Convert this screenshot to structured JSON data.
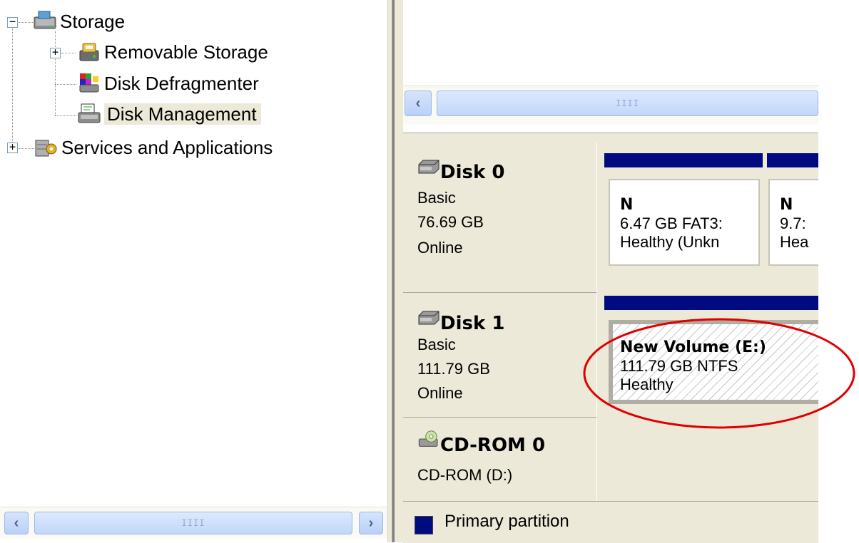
{
  "tree": {
    "storage": {
      "label": "Storage",
      "expander": "−",
      "icon": "storage-icon"
    },
    "removable_storage": {
      "label": "Removable Storage",
      "expander": "+",
      "icon": "removable-storage-icon"
    },
    "disk_defragmenter": {
      "label": "Disk Defragmenter",
      "icon": "defragmenter-icon"
    },
    "disk_management": {
      "label": "Disk Management",
      "icon": "disk-management-icon",
      "selected": true
    },
    "services": {
      "label": "Services and Applications",
      "expander": "+",
      "icon": "services-icon"
    }
  },
  "scroll": {
    "left": "‹",
    "right": "›",
    "grip": "IIII"
  },
  "disks": [
    {
      "name": "Disk 0",
      "type": "Basic",
      "size": "76.69 GB",
      "status": "Online",
      "partitions": [
        {
          "title": "N",
          "size": "6.47 GB FAT3:",
          "status": "Healthy (Unkn"
        },
        {
          "title": "N",
          "size": "9.7:",
          "status": "Hea"
        }
      ]
    },
    {
      "name": "Disk 1",
      "type": "Basic",
      "size": "111.79 GB",
      "status": "Online",
      "partitions": [
        {
          "title": "New Volume  (E:)",
          "size": "111.79 GB NTFS",
          "status": "Healthy"
        }
      ]
    },
    {
      "name": "CD-ROM 0",
      "type": "CD-ROM (D:)"
    }
  ],
  "legend": {
    "label": "Primary partition",
    "color": "#000b80"
  },
  "annotation": {
    "color": "#e00000"
  }
}
